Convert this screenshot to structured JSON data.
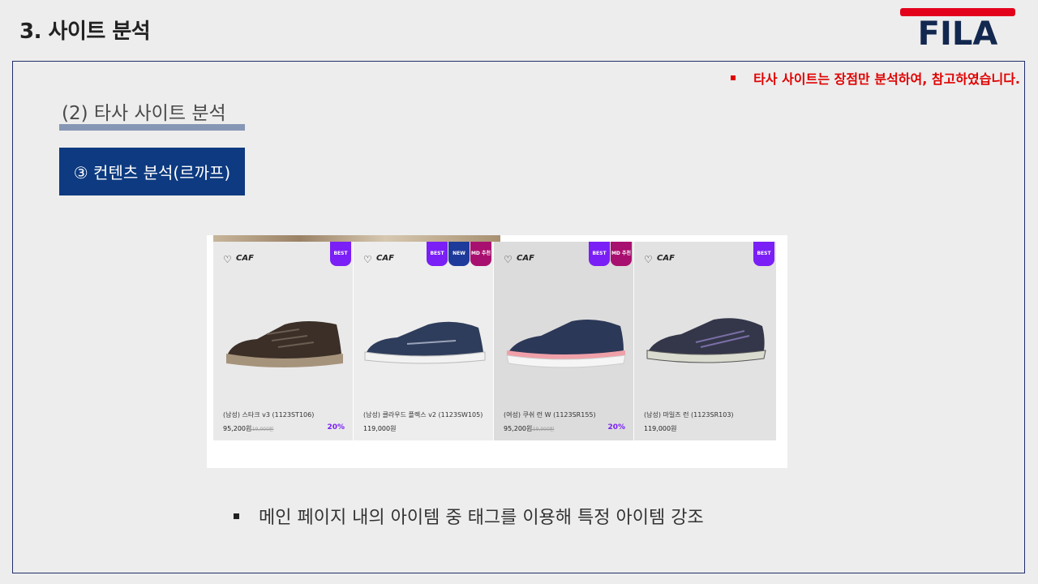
{
  "slide": {
    "title": "3. 사이트 분석",
    "logo_text": "FILA",
    "note": "타사 사이트는 장점만 분석하여, 참고하였습니다.",
    "section_title": "(2) 타사 사이트 분석",
    "subtitle": "③ 컨텐츠 분석(르까프)",
    "bottom_bullet": "메인 페이지 내의 아이템 중 태그를 이용해 특정 아이템 강조"
  },
  "colors": {
    "logo_red": "#e3001b",
    "logo_navy": "#13284f",
    "note_red": "#e00000",
    "subtitle_bg": "#0d3a80",
    "best_badge": "#7a1ff5",
    "new_badge": "#1e3a9a",
    "md_badge": "#a8106f"
  },
  "products": [
    {
      "brand": "CAF",
      "badges": [
        "BEST"
      ],
      "name": "(남성) 스타크 v3 (1123ST106)",
      "price": "95,200원",
      "original": "119,000원",
      "discount": "20%",
      "icon": "heart-icon"
    },
    {
      "brand": "CAF",
      "badges": [
        "BEST",
        "NEW",
        "MD 추천"
      ],
      "name": "(남성) 클라우드 플렉스 v2 (1123SW105)",
      "price": "119,000원",
      "original": "",
      "discount": "",
      "icon": "heart-icon"
    },
    {
      "brand": "CAF",
      "badges": [
        "BEST",
        "MD 추천"
      ],
      "name": "(여성) 쿠쉬 런 W (1123SR155)",
      "price": "95,200원",
      "original": "119,000원",
      "discount": "20%",
      "icon": "heart-icon"
    },
    {
      "brand": "CAF",
      "badges": [
        "BEST"
      ],
      "name": "(남성) 마일즈 런 (1123SR103)",
      "price": "119,000원",
      "original": "",
      "discount": "",
      "icon": "heart-icon"
    }
  ]
}
